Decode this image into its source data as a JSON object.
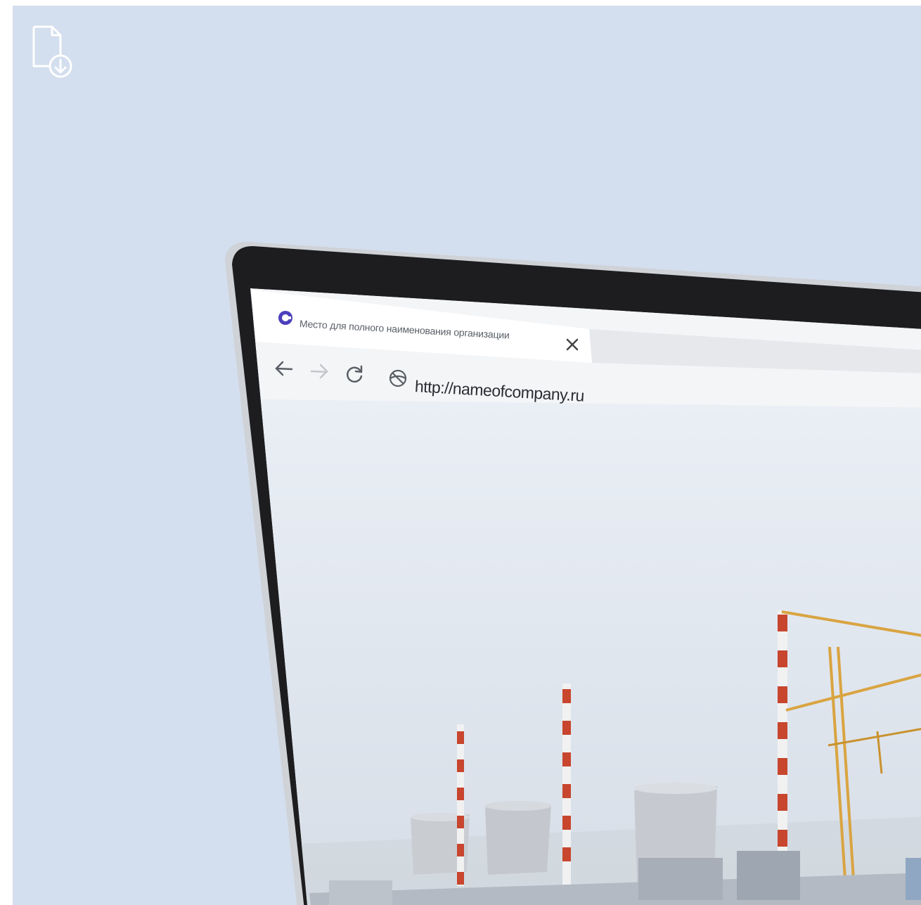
{
  "colors": {
    "background": "#d3deee",
    "bezel": "#1d1d1f",
    "icon_stroke": "#ffffff",
    "favicon": "#4b3fbd"
  },
  "icons": {
    "download": "file-download-icon",
    "favicon": "site-favicon-icon",
    "close": "close-icon",
    "back": "back-arrow-icon",
    "forward": "forward-arrow-icon",
    "reload": "reload-icon",
    "site_info": "globe-icon"
  },
  "browser": {
    "tab_title": "Место для полного наименования организации",
    "url": "http://nameofcompany.ru"
  }
}
